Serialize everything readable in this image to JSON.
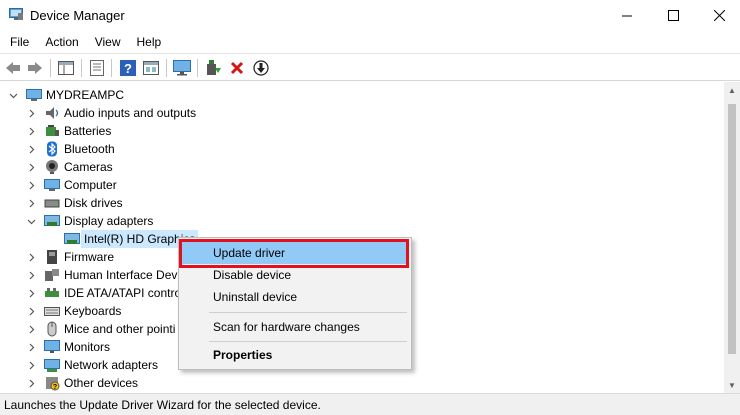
{
  "window": {
    "title": "Device Manager",
    "icon": "device-manager-icon"
  },
  "menubar": {
    "items": [
      "File",
      "Action",
      "View",
      "Help"
    ]
  },
  "toolbar": {
    "buttons": [
      "back-arrow-icon",
      "forward-arrow-icon",
      "show-hide-tree-icon",
      "properties-icon",
      "help-icon",
      "view-icon",
      "monitor-icon",
      "update-driver-icon",
      "uninstall-icon",
      "scan-download-icon"
    ]
  },
  "tree": {
    "root": "MYDREAMPC",
    "items": [
      {
        "label": "Audio inputs and outputs",
        "icon": "speaker-icon"
      },
      {
        "label": "Batteries",
        "icon": "battery-icon"
      },
      {
        "label": "Bluetooth",
        "icon": "bluetooth-icon"
      },
      {
        "label": "Cameras",
        "icon": "camera-icon"
      },
      {
        "label": "Computer",
        "icon": "computer-icon"
      },
      {
        "label": "Disk drives",
        "icon": "disk-drive-icon"
      },
      {
        "label": "Display adapters",
        "icon": "display-adapter-icon",
        "expanded": true
      },
      {
        "label": "Intel(R) HD Graphics",
        "icon": "display-adapter-icon",
        "child": true,
        "selected": true
      },
      {
        "label": "Firmware",
        "icon": "firmware-icon"
      },
      {
        "label": "Human Interface Dev",
        "icon": "hid-icon"
      },
      {
        "label": "IDE ATA/ATAPI contro",
        "icon": "ide-controller-icon"
      },
      {
        "label": "Keyboards",
        "icon": "keyboard-icon"
      },
      {
        "label": "Mice and other pointi",
        "icon": "mouse-icon"
      },
      {
        "label": "Monitors",
        "icon": "monitor-icon"
      },
      {
        "label": "Network adapters",
        "icon": "network-adapter-icon"
      },
      {
        "label": "Other devices",
        "icon": "other-devices-icon"
      }
    ]
  },
  "context_menu": {
    "items": [
      {
        "label": "Update driver",
        "highlighted": true
      },
      {
        "label": "Disable device"
      },
      {
        "label": "Uninstall device"
      },
      {
        "label": "Scan for hardware changes"
      },
      {
        "label": "Properties",
        "bold": true
      }
    ],
    "highlight_color": "#e3101f",
    "hover_color": "#91c9f7"
  },
  "status": {
    "text": "Launches the Update Driver Wizard for the selected device."
  }
}
